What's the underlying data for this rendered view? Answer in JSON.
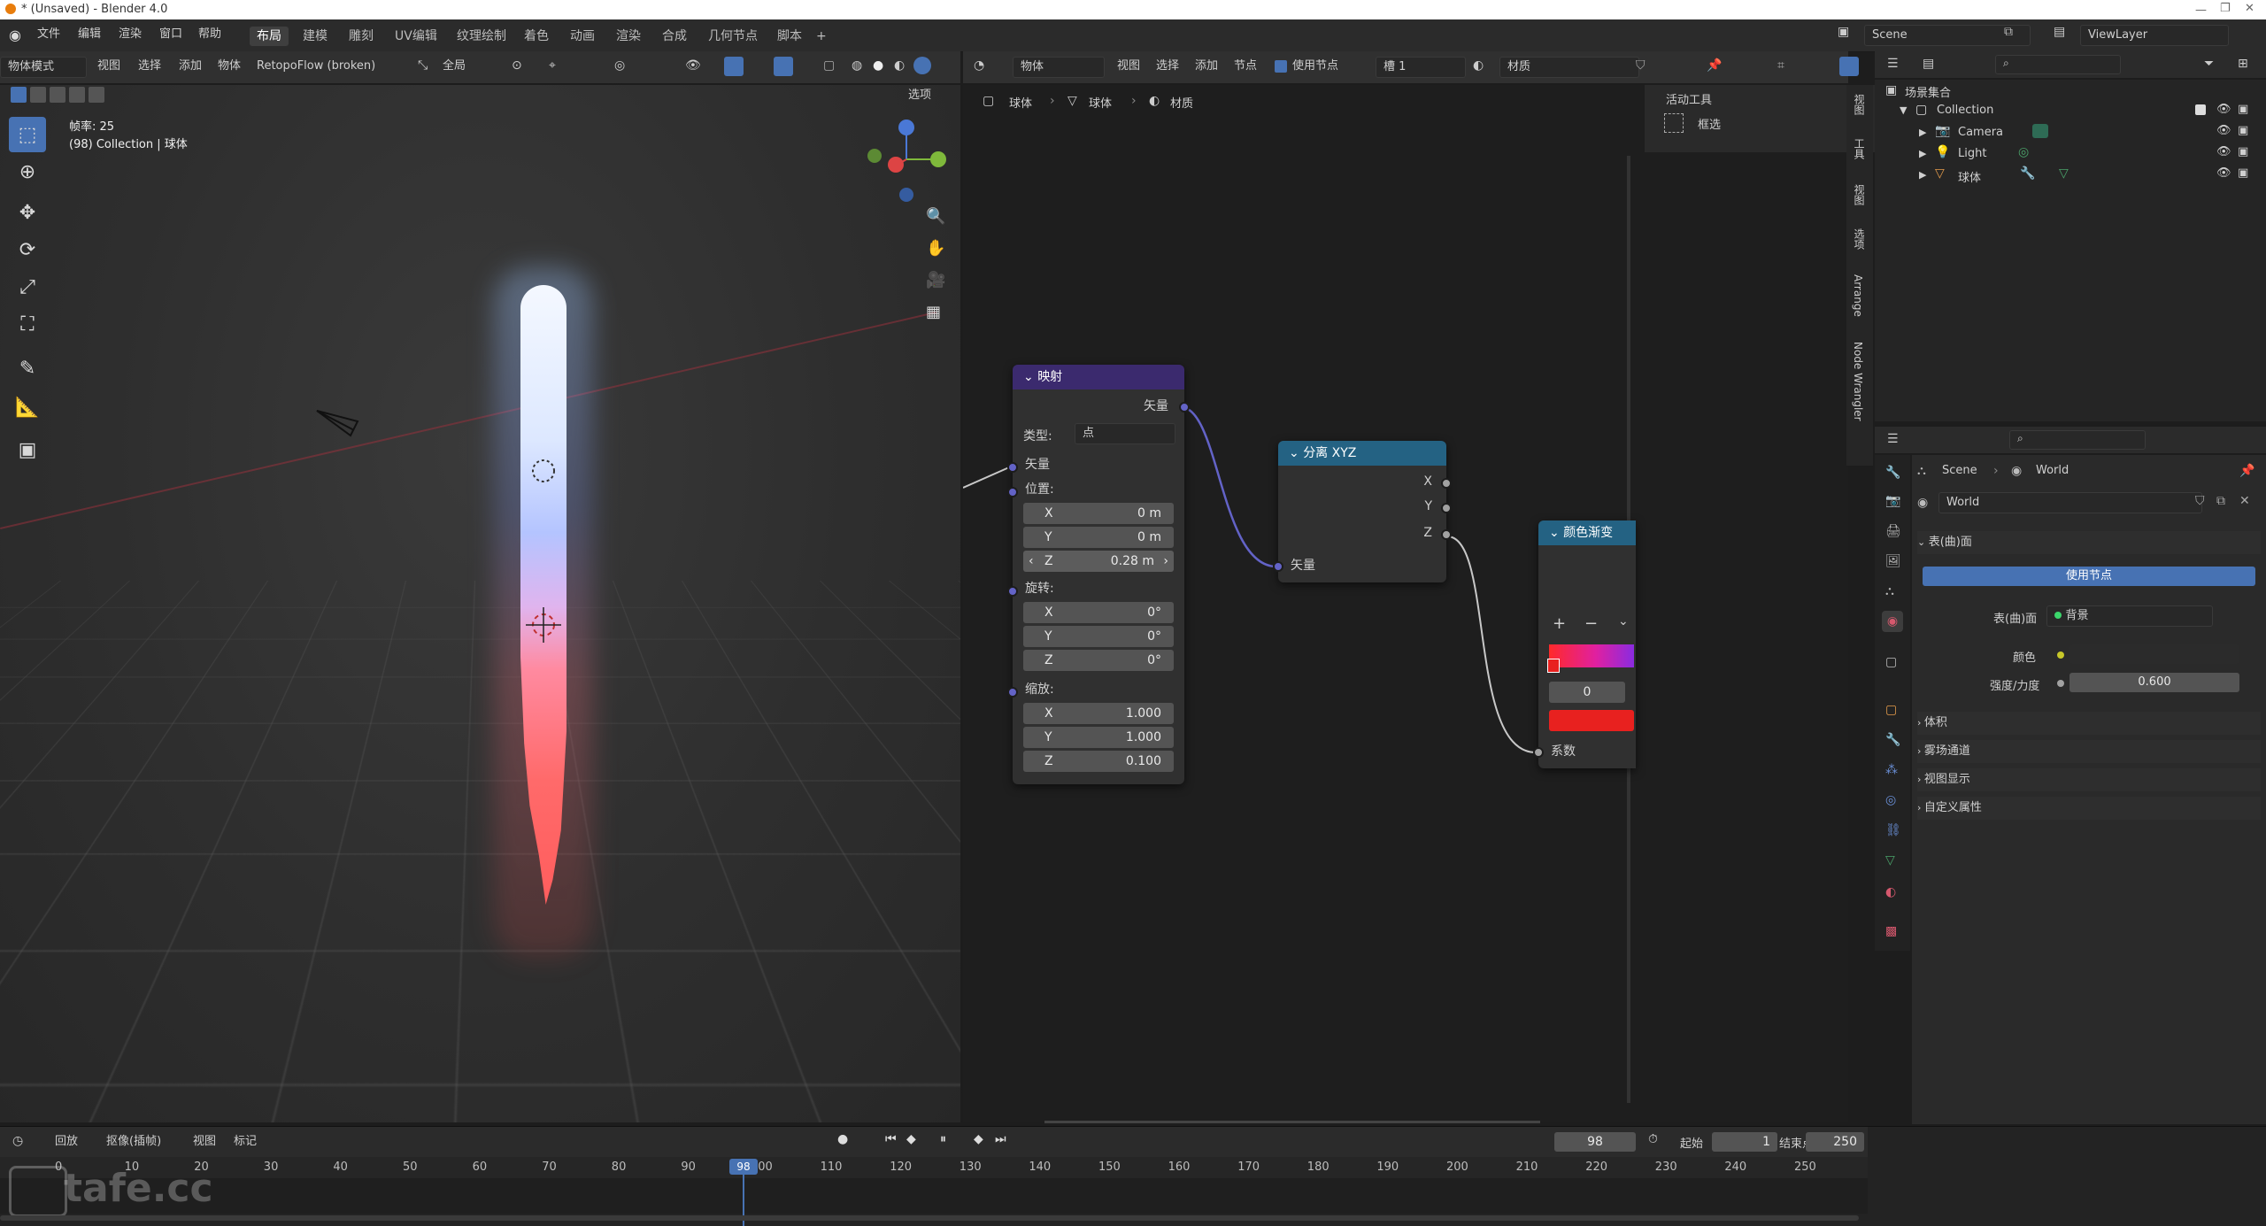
{
  "window": {
    "title": "* (Unsaved) - Blender 4.0"
  },
  "menus": [
    "文件",
    "编辑",
    "渲染",
    "窗口",
    "帮助"
  ],
  "workspaces": [
    "布局",
    "建模",
    "雕刻",
    "UV编辑",
    "纹理绘制",
    "着色",
    "动画",
    "渲染",
    "合成",
    "几何节点",
    "脚本"
  ],
  "top_right": {
    "scene": "Scene",
    "view_layer": "ViewLayer"
  },
  "viewport": {
    "mode": "物体模式",
    "menu": [
      "视图",
      "选择",
      "添加",
      "物体"
    ],
    "addon": "RetopoFlow (broken)",
    "transform_space": "全局",
    "options": "选项",
    "info_line1": "帧率: 25",
    "info_line2": "(98) Collection | 球体"
  },
  "node_editor": {
    "object_mode": "物体",
    "menu": [
      "视图",
      "选择",
      "添加",
      "节点"
    ],
    "use_nodes": "使用节点",
    "slot": "槽 1",
    "material": "材质",
    "breadcrumb": [
      "球体",
      "球体",
      "材质"
    ],
    "tool_panel": {
      "title": "活动工具",
      "tool": "框选"
    },
    "mapping": {
      "title": "映射",
      "output": "矢量",
      "type_label": "类型:",
      "type_value": "点",
      "vector": "矢量",
      "location": "位置:",
      "loc": [
        {
          "axis": "X",
          "val": "0 m"
        },
        {
          "axis": "Y",
          "val": "0 m"
        },
        {
          "axis": "Z",
          "val": "0.28 m"
        }
      ],
      "rotation": "旋转:",
      "rot": [
        {
          "axis": "X",
          "val": "0°"
        },
        {
          "axis": "Y",
          "val": "0°"
        },
        {
          "axis": "Z",
          "val": "0°"
        }
      ],
      "scale": "缩放:",
      "scl": [
        {
          "axis": "X",
          "val": "1.000"
        },
        {
          "axis": "Y",
          "val": "1.000"
        },
        {
          "axis": "Z",
          "val": "0.100"
        }
      ]
    },
    "separate_xyz": {
      "title": "分离 XYZ",
      "out_x": "X",
      "out_y": "Y",
      "out_z": "Z",
      "input": "矢量"
    },
    "color_ramp": {
      "title": "颜色渐变",
      "plus": "+",
      "minus": "−",
      "pos": "0",
      "factor": "系数",
      "stop_color": "#e8211f"
    }
  },
  "side_tabs": [
    "视图",
    "工具",
    "视图",
    "选项",
    "Arrange",
    "Node Wrangler"
  ],
  "outliner": {
    "root": "场景集合",
    "collection": "Collection",
    "items": [
      "Camera",
      "Light",
      "球体"
    ]
  },
  "properties": {
    "breadcrumb": [
      "Scene",
      "World"
    ],
    "world_name": "World",
    "surface": "表(曲)面",
    "use_nodes_btn": "使用节点",
    "surface_label": "表(曲)面",
    "surface_value": "背景",
    "color_label": "颜色",
    "strength_label": "强度/力度",
    "strength_value": "0.600",
    "sections": [
      "体积",
      "雾场通道",
      "视图显示",
      "自定义属性"
    ]
  },
  "timeline": {
    "menu": [
      "回放",
      "抠像(插帧)",
      "视图",
      "标记"
    ],
    "current_frame": "98",
    "start_label": "起始",
    "start": "1",
    "end_label": "结束点",
    "end": "250",
    "ticks": [
      "0",
      "10",
      "20",
      "30",
      "40",
      "50",
      "60",
      "70",
      "80",
      "90",
      "100",
      "110",
      "120",
      "130",
      "140",
      "150",
      "160",
      "170",
      "180",
      "190",
      "200",
      "210",
      "220",
      "230",
      "240",
      "250"
    ],
    "playhead": "98",
    "watermark": "tafe.cc"
  },
  "colors": {
    "accent": "#4772b3",
    "mapping_header": "#3b2a6e",
    "separate_header": "#246283",
    "ramp_header": "#246283",
    "link": "#6363c7"
  }
}
